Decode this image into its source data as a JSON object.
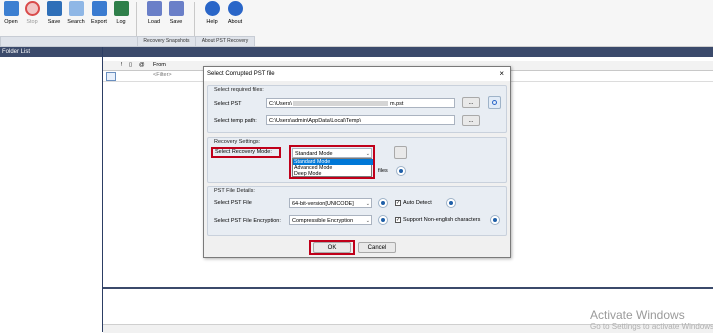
{
  "toolbar": {
    "items": [
      {
        "label": "Open",
        "icon": "open-icon",
        "color": "#3c7fd1"
      },
      {
        "label": "Stop",
        "icon": "stop-icon",
        "color": "#d94b4b"
      },
      {
        "label": "Save",
        "icon": "save-icon",
        "color": "#2f6fb8"
      },
      {
        "label": "Search",
        "icon": "search-icon",
        "color": "#4a8fd6"
      },
      {
        "label": "Export",
        "icon": "export-icon",
        "color": "#3a7bd0"
      },
      {
        "label": "Log",
        "icon": "log-icon",
        "color": "#2f7f4a"
      },
      {
        "label": "Load",
        "icon": "load-icon",
        "color": "#5a6fb8"
      },
      {
        "label": "Save",
        "icon": "snapshot-save-icon",
        "color": "#5a6fb8"
      },
      {
        "label": "Help",
        "icon": "help-icon",
        "color": "#2a66c8"
      },
      {
        "label": "About",
        "icon": "about-icon",
        "color": "#2a66c8"
      }
    ],
    "groups": [
      "Recovery Snapshots",
      "About PST Recovery"
    ]
  },
  "left_panel": {
    "title": "Folder List"
  },
  "grid": {
    "columns": [
      "!",
      "From"
    ],
    "filter_placeholder": "<Filter>"
  },
  "dialog": {
    "title": "Select Corrupted PST file",
    "close": "×",
    "required_files": {
      "legend": "Select required files:",
      "select_pst_label": "Select PST",
      "select_pst_value": "C:\\Users\\",
      "select_pst_value_end": "m.pst",
      "temp_path_label": "Select temp path:",
      "temp_path_value": "C:\\Users\\admin\\AppData\\Local\\Temp\\",
      "browse": "..."
    },
    "recovery_settings": {
      "legend": "Recovery Settings:",
      "mode_label": "Select Recovery Mode:",
      "mode_value": "Standard Mode",
      "mode_options": [
        "Standard Mode",
        "Advanced Mode",
        "Deep Mode"
      ],
      "files_label": "files"
    },
    "pst_details": {
      "legend": "PST File Details:",
      "pst_file_label": "Select PST File",
      "pst_file_value": "64-bit-version[UNICODE]",
      "auto_detect": "Auto Detect",
      "encryption_label": "Select PST File Encryption:",
      "encryption_value": "Compressible Encryption",
      "non_english": "Support Non-english characters"
    },
    "ok": "OK",
    "cancel": "Cancel"
  },
  "watermark": {
    "line1": "Activate Windows",
    "line2": "Go to Settings to activate Windows."
  },
  "colors": {
    "highlight": "#c0001a",
    "selection": "#0078d7",
    "panel_header": "#3b4a6b"
  }
}
